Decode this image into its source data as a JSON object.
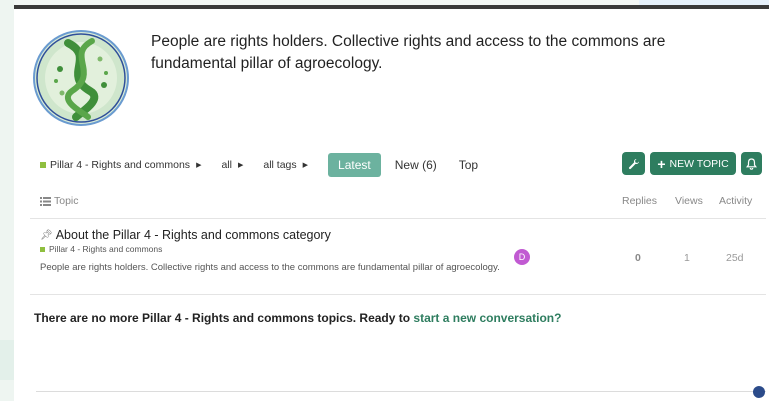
{
  "category": {
    "description": "People are rights holders. Collective rights and access to the commons are fundamental pillar of agroecology.",
    "logo_icon": "agroecology-pillar-logo"
  },
  "nav": {
    "breadcrumb_category": "Pillar 4 - Rights and commons",
    "breadcrumb_all": "all",
    "breadcrumb_tags": "all tags",
    "tabs": [
      {
        "label": "Latest",
        "active": true
      },
      {
        "label": "New (6)",
        "active": false
      },
      {
        "label": "Top",
        "active": false
      }
    ]
  },
  "actions": {
    "new_topic_label": "NEW TOPIC",
    "wrench_icon": "wrench-icon",
    "bell_icon": "bell-icon"
  },
  "table": {
    "headers": {
      "topic": "Topic",
      "replies": "Replies",
      "views": "Views",
      "activity": "Activity"
    },
    "rows": [
      {
        "title": "About the Pillar 4 - Rights and commons category",
        "category": "Pillar 4 - Rights and commons",
        "excerpt": "People are rights holders. Collective rights and access to the commons are fundamental pillar of agroecology.",
        "avatar_letter": "D",
        "replies": "0",
        "views": "1",
        "activity": "25d"
      }
    ]
  },
  "footer": {
    "prefix": "There are no more Pillar 4 - Rights and commons topics. Ready to ",
    "link": "start a new conversation?"
  },
  "colors": {
    "accent": "#2e7d5f",
    "tab_active": "#6cb29f",
    "category_square": "#8fbf3f",
    "avatar": "#c15ad2"
  }
}
